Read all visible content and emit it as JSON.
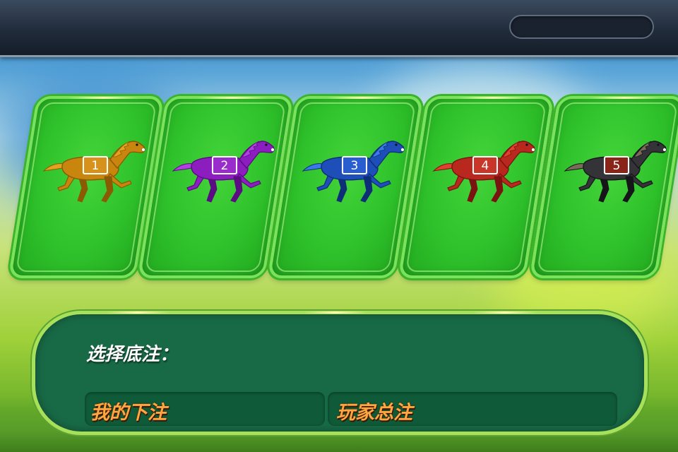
{
  "colors": {
    "card_green": "#2fc22b",
    "panel_green": "#186a46",
    "label_orange": "#ffa640",
    "label_white": "#ffffff"
  },
  "horses": [
    {
      "number": "1",
      "body": "#c8860e",
      "dark": "#8a5a05",
      "mane": "#e6a21e",
      "blanket": "#d6921a",
      "blanket_border": "#ffffff"
    },
    {
      "number": "2",
      "body": "#8c1ec0",
      "dark": "#5b0c82",
      "mane": "#b040e0",
      "blanket": "#9a2ccc",
      "blanket_border": "#ffffff"
    },
    {
      "number": "3",
      "body": "#1e4fb8",
      "dark": "#0f2e78",
      "mane": "#3a7ae6",
      "blanket": "#2a5ed0",
      "blanket_border": "#ffffff"
    },
    {
      "number": "4",
      "body": "#b8281e",
      "dark": "#7a1410",
      "mane": "#e04030",
      "blanket": "#c8362a",
      "blanket_border": "#ffffff"
    },
    {
      "number": "5",
      "body": "#333338",
      "dark": "#16161a",
      "mane": "#7a6a58",
      "blanket": "#8a2418",
      "blanket_border": "#ffffff"
    }
  ],
  "bet_panel": {
    "choose_label": "选择底注：",
    "my_bet_label": "我的下注",
    "total_bet_label": "玩家总注"
  }
}
